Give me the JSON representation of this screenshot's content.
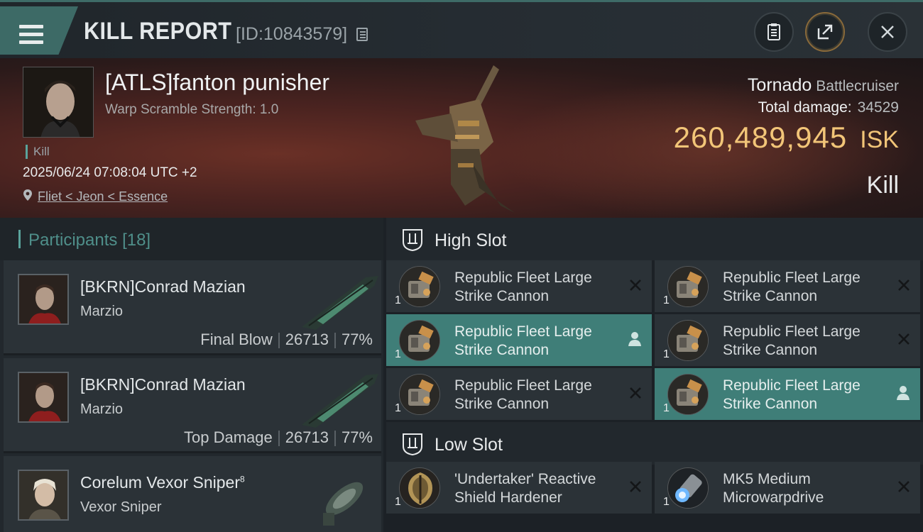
{
  "header": {
    "title": "KILL REPORT",
    "report_id": "[ID:10843579]"
  },
  "victim": {
    "name": "[ATLS]fanton punisher",
    "scramble": "Warp Scramble Strength: 1.0",
    "tag": "Kill",
    "timestamp": "2025/06/24 07:08:04 UTC +2",
    "location": "Fliet < Jeon < Essence",
    "ship_name": "Tornado",
    "ship_class": "Battlecruiser",
    "damage_label": "Total damage:",
    "damage_value": "34529",
    "isk_value": "260,489,945",
    "isk_unit": "ISK",
    "result": "Kill"
  },
  "participants": {
    "label": "Participants",
    "count": "[18]",
    "rows": [
      {
        "name": "[BKRN]Conrad Mazian",
        "sup": "",
        "ship": "Marzio",
        "role": "Final Blow",
        "damage": "26713",
        "percent": "77%"
      },
      {
        "name": "[BKRN]Conrad Mazian",
        "sup": "",
        "ship": "Marzio",
        "role": "Top Damage",
        "damage": "26713",
        "percent": "77%"
      },
      {
        "name": "Corelum Vexor Sniper",
        "sup": "8",
        "ship": "Vexor Sniper",
        "role": "",
        "damage": "",
        "percent": ""
      }
    ]
  },
  "fittings": {
    "high_slot_label": "High Slot",
    "low_slot_label": "Low Slot",
    "high": [
      {
        "name": "Republic Fleet Large Strike Cannon",
        "qty": "1",
        "state": "destroyed",
        "icon": "cannon-icon"
      },
      {
        "name": "Republic Fleet Large Strike Cannon",
        "qty": "1",
        "state": "destroyed",
        "icon": "cannon-icon"
      },
      {
        "name": "Republic Fleet Large Strike Cannon",
        "qty": "1",
        "state": "dropped",
        "icon": "cannon-icon"
      },
      {
        "name": "Republic Fleet Large Strike Cannon",
        "qty": "1",
        "state": "destroyed",
        "icon": "cannon-icon"
      },
      {
        "name": "Republic Fleet Large Strike Cannon",
        "qty": "1",
        "state": "destroyed",
        "icon": "cannon-icon"
      },
      {
        "name": "Republic Fleet Large Strike Cannon",
        "qty": "1",
        "state": "dropped",
        "icon": "cannon-icon"
      }
    ],
    "low": [
      {
        "name": "'Undertaker' Reactive Shield Hardener",
        "qty": "1",
        "state": "destroyed",
        "icon": "shield-hardener-icon"
      },
      {
        "name": "MK5 Medium Microwarpdrive",
        "qty": "1",
        "state": "destroyed",
        "icon": "microwarpdrive-icon"
      }
    ]
  },
  "colors": {
    "accent": "#3f7e78",
    "isk": "#f2c578",
    "participants_label": "#4f8f8a"
  }
}
